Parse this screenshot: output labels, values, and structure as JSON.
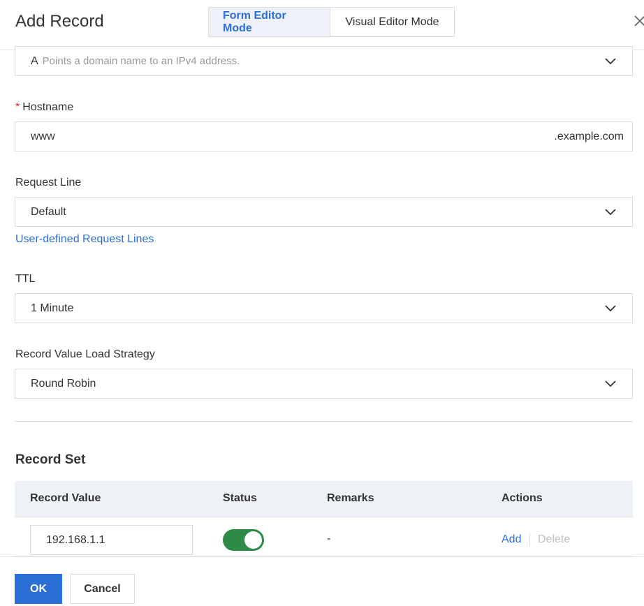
{
  "dialog": {
    "title": "Add Record",
    "modes": [
      "Form Editor Mode",
      "Visual Editor Mode"
    ],
    "active_mode": "Form Editor Mode"
  },
  "record_type": {
    "code": "A",
    "description": "Points a domain name to an IPv4 address."
  },
  "hostname": {
    "label": "Hostname",
    "required_marker": "*",
    "value": "www",
    "suffix": ".example.com"
  },
  "request_line": {
    "label": "Request Line",
    "value": "Default",
    "link": "User-defined Request Lines"
  },
  "ttl": {
    "label": "TTL",
    "value": "1 Minute"
  },
  "load_strategy": {
    "label": "Record Value Load Strategy",
    "value": "Round Robin"
  },
  "record_set": {
    "title": "Record Set",
    "columns": [
      "Record Value",
      "Status",
      "Remarks",
      "Actions"
    ],
    "rows": [
      {
        "value": "192.168.1.1",
        "status_enabled": true,
        "remarks": "-",
        "actions": [
          "Add",
          "Delete"
        ]
      }
    ]
  },
  "footer": {
    "ok": "OK",
    "cancel": "Cancel"
  },
  "colors": {
    "accent": "#2b6fd6",
    "toggle_on": "#2e8a47",
    "required": "#d9262b"
  }
}
